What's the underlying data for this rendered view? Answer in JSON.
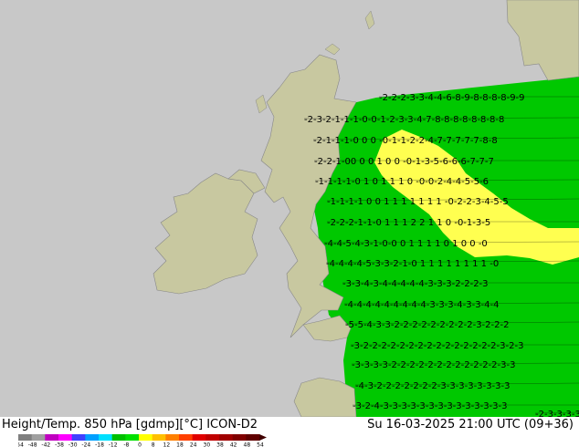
{
  "footer": {
    "title_left": "Height/Temp. 850 hPa [gdmp][°C] ICON-D2",
    "title_right": "Su 16-03-2025 21:00 UTC (09+36)"
  },
  "colors": {
    "sea": "#c8c8c8",
    "land": "#c8c8a0",
    "model_domain": "#00c800",
    "cold_band": "#00e000",
    "warm_patch": "#ffff50",
    "isoline": "#000000"
  },
  "colorbar": {
    "ticks": [
      "-54",
      "-48",
      "-42",
      "-38",
      "-30",
      "-24",
      "-18",
      "-12",
      "-8",
      "0",
      "8",
      "12",
      "18",
      "24",
      "30",
      "38",
      "42",
      "48",
      "54"
    ],
    "colors": [
      "#808080",
      "#a0a0a0",
      "#c000c0",
      "#ff00ff",
      "#4040ff",
      "#00a0ff",
      "#00e0ff",
      "#00c000",
      "#00e000",
      "#ffff00",
      "#ffc000",
      "#ff8000",
      "#ff4000",
      "#e00000",
      "#c00000",
      "#a00000",
      "#800000",
      "#600000"
    ]
  },
  "isolines": [
    {
      "label": "-2-2-2-3-3-4-4-6-8-9-8-8-8-8-9-9"
    },
    {
      "label": "-2-3-2-1-1-1-0-0-1-2-3-3-4-7-8-8-8-8-8-8-8-8"
    },
    {
      "label": "-2-1-1-1-0 0 0 -0-1-1-2-2-4-7-7-7-7-7-8-8"
    },
    {
      "label": "-2-2-1-00 0 0 1 0 0 -0-1-3-5-6-6-6-7-7-7"
    },
    {
      "label": "-1-1-1-1-0 1 0 1 1 1 0 -0-0-2-4-4-5-5-6"
    },
    {
      "label": "-1-1-1-1 0 0 1 1 1 1 1 1 1 -0-2-2-3-4-5-5"
    },
    {
      "label": "-2-2-2-1-1-0 1 1 1 2 2 1 1 0 -0-1-3-5"
    },
    {
      "label": "-4-4-5-4-3-1-0-0 0 1 1 1 1 0 1 0 0 -0"
    },
    {
      "label": "-4-4-4-4-5-3-3-2-1-0 1 1 1 1 1 1 1 1 -0"
    },
    {
      "label": "-3-3-4-3-4-4-4-4-4-3-3-3-2-2-2-3"
    },
    {
      "label": "-4-4-4-4-4-4-4-4-4-3-3-3-4-3-3-4-4"
    },
    {
      "label": "-5-5-4-3-3-2-2-2-2-2-2-2-2-2-3-2-2-2"
    },
    {
      "label": "-3-2-2-2-2-2-2-2-2-2-2-2-2-2-2-2-3-2-3"
    },
    {
      "label": "-3-3-3-3-2-2-2-2-2-2-2-2-2-2-2-2-3-3"
    },
    {
      "label": "-4-3-2-2-2-2-2-2-2-3-3-3-3-3-3-3-3"
    },
    {
      "label": "-3-2-4-3-3-3-3-3-3-3-3-3-3-3-3-3-3"
    },
    {
      "label": "-2-3-3-3-3"
    }
  ]
}
